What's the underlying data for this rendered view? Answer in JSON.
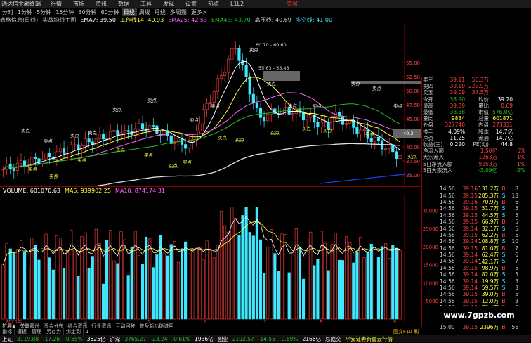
{
  "app": {
    "title": "通达信金融终端",
    "trade_label": "交易"
  },
  "menu": [
    "行情",
    "市场",
    "资讯",
    "数据",
    "工具",
    "发现",
    "设置",
    "热点",
    "L1L2"
  ],
  "periods": [
    "分时",
    "1分钟",
    "5分钟",
    "15分钟",
    "30分钟",
    "60分钟",
    "日线",
    "周线",
    "月线",
    "多周期",
    "更多>"
  ],
  "active_period": "日线",
  "kline_info": {
    "name": "表格信息(日线)",
    "indicator": "实战均线主图",
    "ema7": "EMA7: 39.50",
    "line14": "工作线14: 40.93",
    "ema25": "EMA25: 42.53",
    "ema43": "EMA43: 43.70",
    "high_line": "高压线: 40.69",
    "extra": "多空线: 41.00"
  },
  "price_axis": [
    "55.00",
    "52.50",
    "50.00",
    "47.50",
    "45.00",
    "42.50",
    "40.00",
    "37.50",
    "35.00"
  ],
  "annotations": {
    "high": "60.70 - 60.60",
    "mid": "55.63 - 53.43",
    "last": "40.3"
  },
  "signals": {
    "buy": "买点",
    "sell": "卖点"
  },
  "volume_info": {
    "volume": "VOLUME: 601070.63",
    "ma5": "MA5: 939902.25",
    "ma10": "MA10: 874174.31"
  },
  "vol_axis": [
    "30000",
    "25000",
    "20000",
    "15000",
    "10000",
    "5000"
  ],
  "x_labels": [
    "2023年",
    "4",
    "5",
    "6",
    "7",
    "8",
    "9"
  ],
  "bottom_tabs": [
    "指标",
    "模板",
    "管理",
    "另存为",
    "绑定到",
    "1"
  ],
  "bottom_tabs2": [
    "扩展▲",
    "关联股份",
    "资金分布",
    "综合资讯",
    "行业资讯",
    "互动问答",
    "普及新功能说明"
  ],
  "bottom_right": "图文F10 刷",
  "quote_panel": [
    {
      "l": "卖三",
      "v": "39.11",
      "q": "56.3万",
      "vc": "red"
    },
    {
      "l": "卖四",
      "v": "39.10",
      "q": "222.9万",
      "vc": "red"
    },
    {
      "l": "卖五",
      "v": "39.09",
      "q": "37.5万",
      "vc": "red"
    },
    {
      "l": "今开",
      "v": "38.90",
      "q": "均价",
      "q2": "39.20",
      "vc": "grn"
    },
    {
      "l": "最高",
      "v": "39.89",
      "q": "量比",
      "q2": "0.69",
      "vc": "red"
    },
    {
      "l": "最低",
      "v": "38.38",
      "q": "市值",
      "q2": "576.0亿",
      "vc": "grn"
    },
    {
      "l": "量比",
      "v": "9834",
      "q": "总量",
      "q2": "601871",
      "vc": "yel"
    },
    {
      "l": "外盘",
      "v": "327740",
      "q": "内盘",
      "q2": "273331",
      "vc": "red"
    },
    {
      "l": "换手",
      "v": "4.09%",
      "q": "股本",
      "q2": "14.7亿",
      "vc": "wh"
    },
    {
      "l": "净资",
      "v": "11.25",
      "q": "流通",
      "q2": "14.7亿",
      "vc": "wh"
    },
    {
      "l": "收益(三)",
      "v": "0.220",
      "q": "PE(动)",
      "q2": "44.8",
      "vc": "wh"
    }
  ],
  "flow_panel": [
    {
      "l": "净流入额",
      "v": "1.50亿",
      "p": "6%"
    },
    {
      "l": "大宗流入",
      "v": "1263万",
      "p": "1%"
    },
    {
      "l": "5日净流入额",
      "v": "9253万",
      "p": "1%"
    },
    {
      "l": "5日大宗流入",
      "v": "-3.09亿",
      "p": "-2%"
    }
  ],
  "deals": [
    {
      "t": "14:56",
      "p": "39.16",
      "n": "131.2万",
      "d": "B",
      "k": "8"
    },
    {
      "t": "14:56",
      "p": "39.15",
      "n": "285.3万",
      "d": "S",
      "k": "13"
    },
    {
      "t": "14:56",
      "p": "39.16",
      "n": "70.9万",
      "d": "B",
      "k": "6"
    },
    {
      "t": "14:56",
      "p": "39.15",
      "n": "51.7万",
      "d": "S",
      "k": "5"
    },
    {
      "t": "14:56",
      "p": "39.15",
      "n": "44.5万",
      "d": "S",
      "k": "5"
    },
    {
      "t": "14:56",
      "p": "39.15",
      "n": "66.9万",
      "d": "B",
      "k": "5"
    },
    {
      "t": "14:56",
      "p": "39.14",
      "n": "32.1万",
      "d": "S",
      "k": "5"
    },
    {
      "t": "14:56",
      "p": "39.15",
      "n": "62.2万",
      "d": "B",
      "k": "5"
    },
    {
      "t": "14:56",
      "p": "39.14",
      "n": "108.8万",
      "d": "S",
      "k": "10"
    },
    {
      "t": "14:56",
      "p": "39.15",
      "n": "81.0万",
      "d": "B",
      "k": "7"
    },
    {
      "t": "14:56",
      "p": "39.14",
      "n": "62.4万",
      "d": "S",
      "k": "6"
    },
    {
      "t": "14:56",
      "p": "39.14",
      "n": "142.1万",
      "d": "S",
      "k": "7"
    },
    {
      "t": "14:56",
      "p": "39.15",
      "n": "98.9万",
      "d": "B",
      "k": "5"
    },
    {
      "t": "14:56",
      "p": "39.14",
      "n": "82.0万",
      "d": "S",
      "k": "5"
    },
    {
      "t": "14:56",
      "p": "39.14",
      "n": "19.9万",
      "d": "S",
      "k": "3"
    },
    {
      "t": "14:56",
      "p": "39.14",
      "n": "59.5万",
      "d": "S",
      "k": "3"
    },
    {
      "t": "14:56",
      "p": "39.15",
      "n": "39.0万",
      "d": "B",
      "k": "5"
    },
    {
      "t": "14:56",
      "p": "39.15",
      "n": "12.0万",
      "d": "B",
      "k": "3"
    },
    {
      "t": "14:56",
      "p": "39.15",
      "n": "70.4万",
      "d": "B",
      "k": "5"
    },
    {
      "t": "14:56",
      "p": "39.15",
      "n": "75.3万",
      "d": "B",
      "k": "6"
    },
    {
      "t": "14:56",
      "p": "39.15",
      "n": "24.1万",
      "d": "B",
      "k": "3"
    },
    {
      "t": "15:00",
      "p": "39.15",
      "n": "2396万",
      "d": "B",
      "k": "56"
    }
  ],
  "ticker": [
    {
      "name": "上证",
      "val": "3119.88",
      "chg": "-17.26",
      "pct": "-0.55%",
      "amt": "3625亿"
    },
    {
      "name": "沪深",
      "val": "3765.27",
      "chg": "-23.24",
      "pct": "-0.61%",
      "amt": "1936亿"
    },
    {
      "name": "创业",
      "val": "2102.57",
      "chg": "-14.55",
      "pct": "-0.69%",
      "amt": "2166亿"
    }
  ],
  "ticker_extra": [
    "总成交",
    "平安证券新疆云行情"
  ],
  "watermark": "www.7gpzb.com",
  "colors": {
    "up": "#ff4040",
    "down": "#40e8ff",
    "ema7": "#ffffff",
    "ema14": "#ffff40",
    "ema25": "#ff60ff",
    "ema43": "#20c020"
  }
}
